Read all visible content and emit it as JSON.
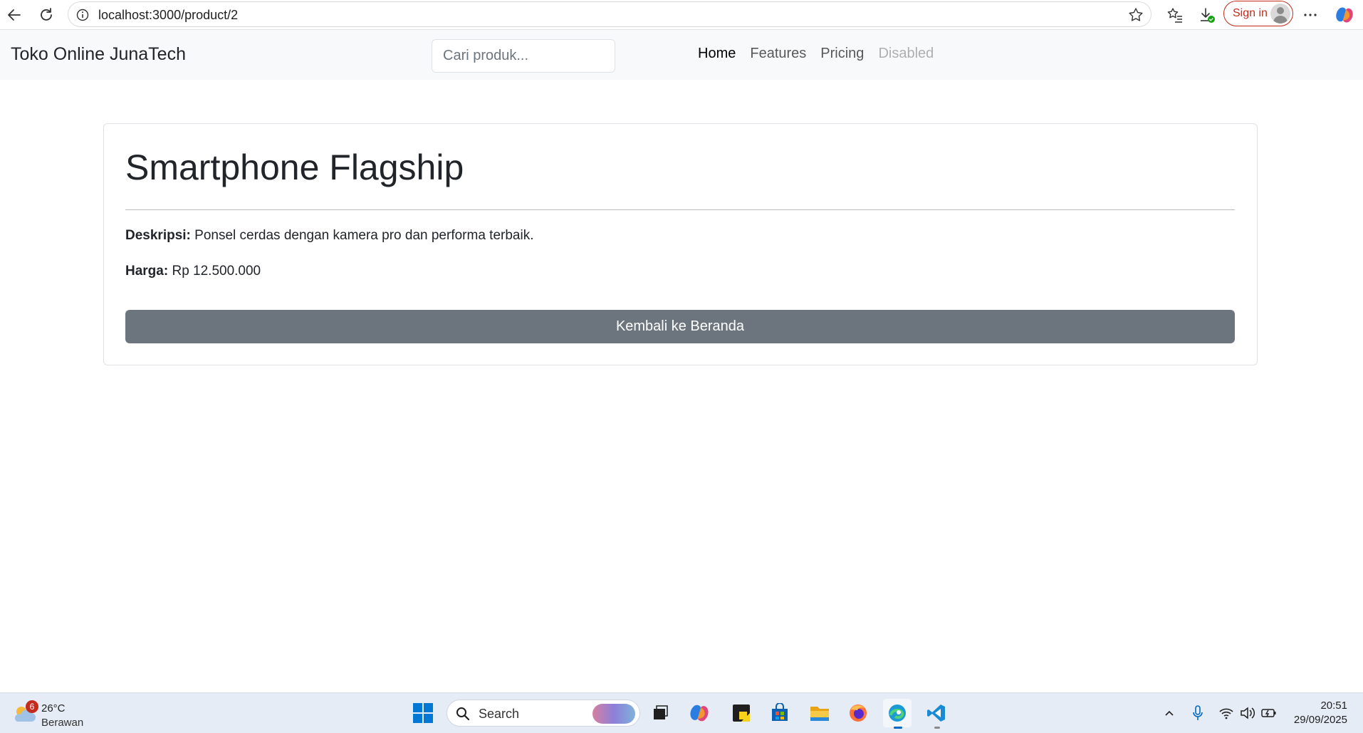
{
  "browser": {
    "url": "localhost:3000/product/2",
    "sign_in_label": "Sign in"
  },
  "site": {
    "brand": "Toko Online JunaTech",
    "search_placeholder": "Cari produk...",
    "nav": [
      {
        "label": "Home",
        "state": "active"
      },
      {
        "label": "Features",
        "state": "normal"
      },
      {
        "label": "Pricing",
        "state": "normal"
      },
      {
        "label": "Disabled",
        "state": "disabled"
      }
    ]
  },
  "product": {
    "title": "Smartphone Flagship",
    "description_label": "Deskripsi:",
    "description": "Ponsel cerdas dengan kamera pro dan performa terbaik.",
    "price_label": "Harga:",
    "price": "Rp 12.500.000",
    "back_button": "Kembali ke Beranda"
  },
  "taskbar": {
    "weather_temp": "26°C",
    "weather_condition": "Berawan",
    "weather_badge": "6",
    "search_label": "Search",
    "time": "20:51",
    "date": "29/09/2025"
  },
  "colors": {
    "button_secondary": "#6c757d",
    "navbar_bg": "#f8f9fa",
    "sign_in_accent": "#c42b1c"
  }
}
